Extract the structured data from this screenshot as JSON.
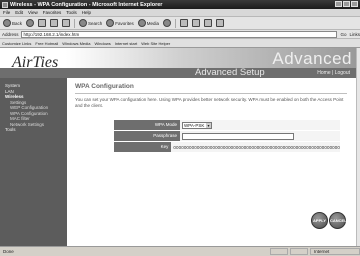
{
  "window": {
    "title": "Wireless - WPA Configuration - Microsoft Internet Explorer"
  },
  "menu": [
    "File",
    "Edit",
    "View",
    "Favorites",
    "Tools",
    "Help"
  ],
  "toolbar": {
    "back": "Back",
    "search": "Search",
    "favorites": "Favorites",
    "media": "Media"
  },
  "address": {
    "label": "Address",
    "value": "http://192.168.2.1/index.htm",
    "go": "Go",
    "links": "Links"
  },
  "links": [
    "Customize Links",
    "Free Hotmail",
    "Windows Media",
    "Windows",
    "Internet start",
    "Web Site Helper"
  ],
  "header": {
    "logo": "AirTies",
    "brand_big": "Advanced",
    "brand_sub": "Advanced Setup",
    "home_link": "Home",
    "logout_link": "Logout",
    "accent": "#6e6e6e"
  },
  "sidebar": {
    "items": [
      {
        "label": "System",
        "level": 0
      },
      {
        "label": "LAN",
        "level": 0
      },
      {
        "label": "Wireless",
        "level": 0,
        "active": true
      },
      {
        "label": "Settings",
        "level": 1
      },
      {
        "label": "WEP Configuration",
        "level": 1
      },
      {
        "label": "WPA Configuration",
        "level": 1
      },
      {
        "label": "MAC filter",
        "level": 1
      },
      {
        "label": "Network Settings",
        "level": 1
      },
      {
        "label": "Tools",
        "level": 0
      }
    ]
  },
  "content": {
    "title": "WPA Configuration",
    "description": "You can set your WPA configuration here. Using WPA provides better network security. WPA must be enabled on both the Access Point and the client.",
    "form": {
      "wpa_mode_label": "WPA Mode",
      "wpa_mode_value": "WPA-PSK",
      "passphrase_label": "Passphrase",
      "passphrase_value": "",
      "key_label": "Key",
      "key_value": "0000000000000000000000000000000000000000000000000000000000000000"
    },
    "apply_label": "APPLY",
    "cancel_label": "CANCEL"
  },
  "status": {
    "left": "Done",
    "zone": "Internet"
  }
}
